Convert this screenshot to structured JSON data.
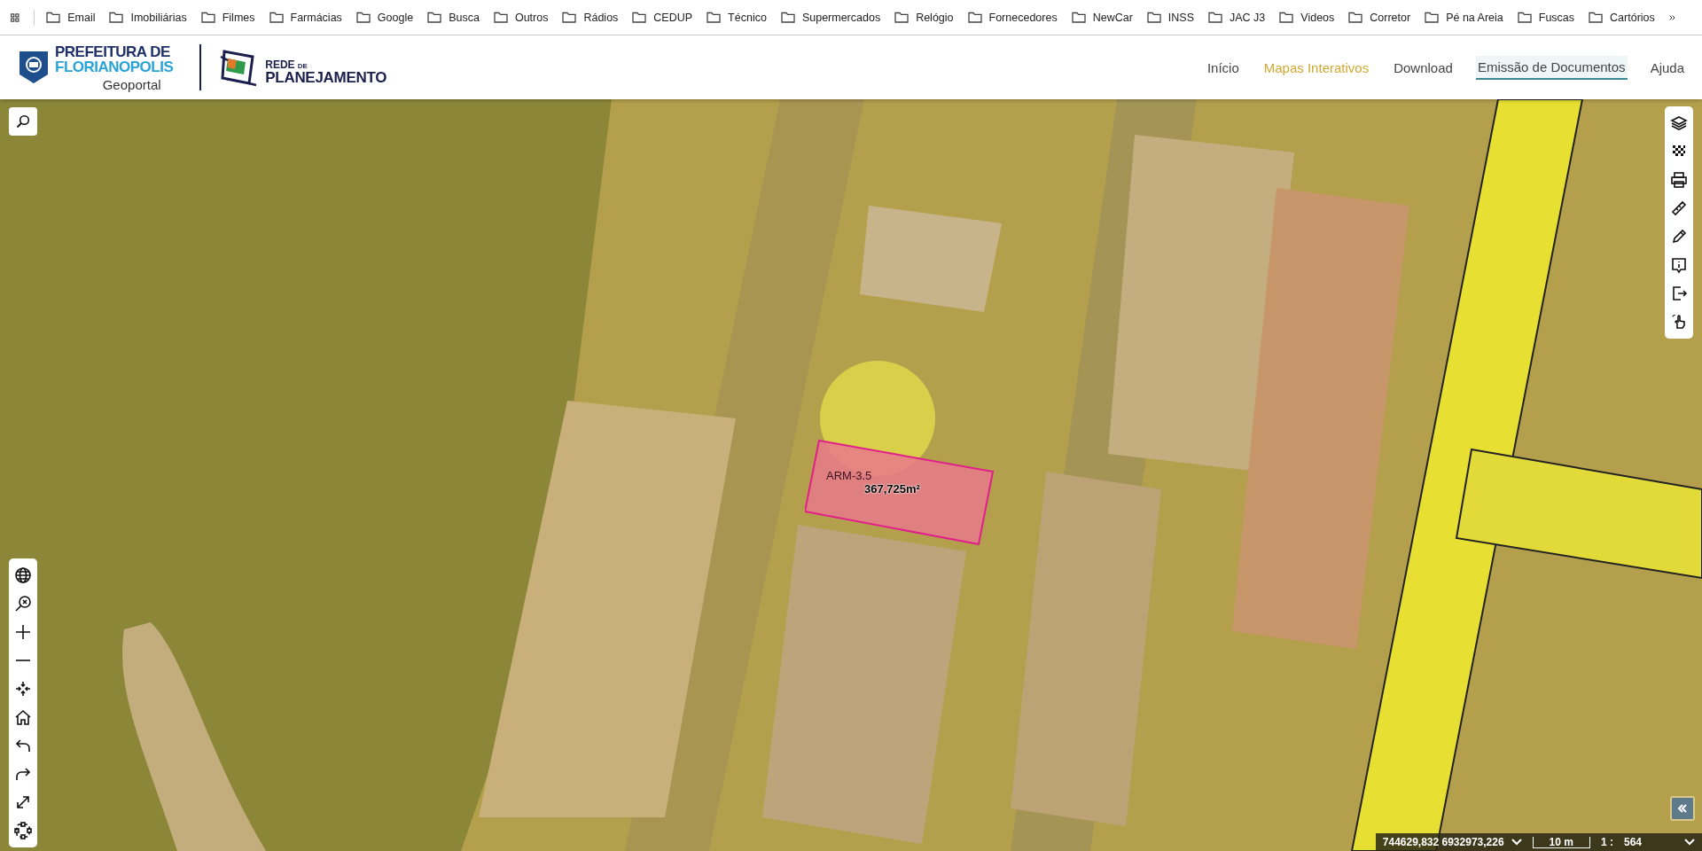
{
  "bookmarks_bar": {
    "items": [
      {
        "label": "Email"
      },
      {
        "label": "Imobiliárias"
      },
      {
        "label": "Filmes"
      },
      {
        "label": "Farmácias"
      },
      {
        "label": "Google"
      },
      {
        "label": "Busca"
      },
      {
        "label": "Outros"
      },
      {
        "label": "Rádios"
      },
      {
        "label": "CEDUP"
      },
      {
        "label": "Técnico"
      },
      {
        "label": "Supermercados"
      },
      {
        "label": "Relógio"
      },
      {
        "label": "Fornecedores"
      },
      {
        "label": "NewCar"
      },
      {
        "label": "INSS"
      },
      {
        "label": "JAC J3"
      },
      {
        "label": "Videos"
      },
      {
        "label": "Corretor"
      },
      {
        "label": "Pé na Areia"
      },
      {
        "label": "Fuscas"
      },
      {
        "label": "Cartórios"
      }
    ]
  },
  "header": {
    "logo": {
      "line_1": "PREFEITURA DE",
      "line_2": "FLORIANOPOLIS",
      "subtitle": "Geoportal"
    },
    "partner_logo": {
      "word_1": "REDE",
      "word_2": "DE",
      "word_3": "PLANEJAMENTO"
    },
    "nav": [
      {
        "label": "Início",
        "selected": false,
        "underlined": false
      },
      {
        "label": "Mapas Interativos",
        "selected": true,
        "underlined": false
      },
      {
        "label": "Download",
        "selected": false,
        "underlined": false
      },
      {
        "label": "Emissão de Documentos",
        "selected": false,
        "underlined": true
      },
      {
        "label": "Ajuda",
        "selected": false,
        "underlined": false
      }
    ]
  },
  "map": {
    "parcel": {
      "zone": "ARM-3.5",
      "area": "367,725m²"
    },
    "status_bar": {
      "coordinates": "744629,832 6932973,226",
      "scale_label": "10 m",
      "ratio_prefix": "1 :",
      "ratio_value": "564"
    }
  }
}
